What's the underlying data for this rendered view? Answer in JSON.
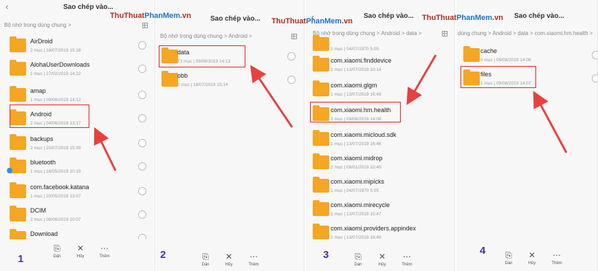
{
  "watermark": {
    "part1": "ThuThuat",
    "part2": "PhanMem",
    "part3": ".vn"
  },
  "colors": {
    "folder": "#f5a623",
    "highlight": "#e02020",
    "arrow": "#e84040",
    "step": "#4b2e9c"
  },
  "bottom_bar": {
    "paste": "Dán",
    "cancel": "Hủy",
    "more": "Thêm"
  },
  "panel1": {
    "title": "Sao chép vào...",
    "breadcrumb": "Bộ nhớ trong dùng chung >",
    "step": "1",
    "items": [
      {
        "name": "AirDroid",
        "meta": "2 mục | 18/07/2019 15:18"
      },
      {
        "name": "AlohaUserDownloads",
        "meta": "1 mục | 27/02/2019 14:22"
      },
      {
        "name": "amap",
        "meta": "1 mục | 09/08/2019 14:12"
      },
      {
        "name": "Android",
        "meta": "2 mục | 04/06/2019 13:17"
      },
      {
        "name": "backups",
        "meta": "2 mục | 20/07/2019 15:39"
      },
      {
        "name": "bluetooth",
        "meta": "1 mục | 16/05/2019 10:19"
      },
      {
        "name": "com.facebook.katana",
        "meta": "1 mục | 20/05/2019 13:07"
      },
      {
        "name": "DCIM",
        "meta": "2 mục | 08/06/2019 10:07"
      },
      {
        "name": "Download",
        "meta": ""
      }
    ]
  },
  "panel2": {
    "title": "Sao chép vào...",
    "breadcrumb": "Bộ nhớ trong dùng chung > Android >",
    "step": "2",
    "items": [
      {
        "name": "data",
        "meta": "73 mục | 09/08/2019 14:13"
      },
      {
        "name": "obb",
        "meta": "2 mục | 18/07/2019 15:14"
      }
    ]
  },
  "panel3": {
    "title": "Sao chép vào...",
    "breadcrumb": "Bộ nhớ trong dùng chung > Android > data >",
    "step": "3",
    "items": [
      {
        "name": "",
        "meta": "1 mục | 04/07/1970 5:05"
      },
      {
        "name": "com.xiaomi.finddevice",
        "meta": "1 mục | 13/07/2019 10:14"
      },
      {
        "name": "com.xiaomi.glgm",
        "meta": "1 mục | 13/07/2019 16:48"
      },
      {
        "name": "com.xiaomi.hm.health",
        "meta": "2 mục | 09/08/2019 14:06"
      },
      {
        "name": "com.xiaomi.micloud.sdk",
        "meta": "1 mục | 13/07/2019 16:46"
      },
      {
        "name": "com.xiaomi.midrop",
        "meta": "2 mục | 09/01/2019 10:49"
      },
      {
        "name": "com.xiaomi.mipicks",
        "meta": "1 mục | 04/07/1970 5:05"
      },
      {
        "name": "com.xiaomi.mirecycle",
        "meta": "1 mục | 13/07/2019 15:47"
      },
      {
        "name": "com.xiaomi.providers.appindex",
        "meta": "1 mục | 13/07/2019 16:49"
      }
    ]
  },
  "panel4": {
    "title": "Sao chép vào...",
    "breadcrumb": "dùng chung > Android > data > com.xiaomi.hm.health >",
    "step": "4",
    "items": [
      {
        "name": "cache",
        "meta": "0 mục | 09/08/2019 14:06"
      },
      {
        "name": "files",
        "meta": "1 mục | 09/08/2019 14:07"
      }
    ]
  }
}
